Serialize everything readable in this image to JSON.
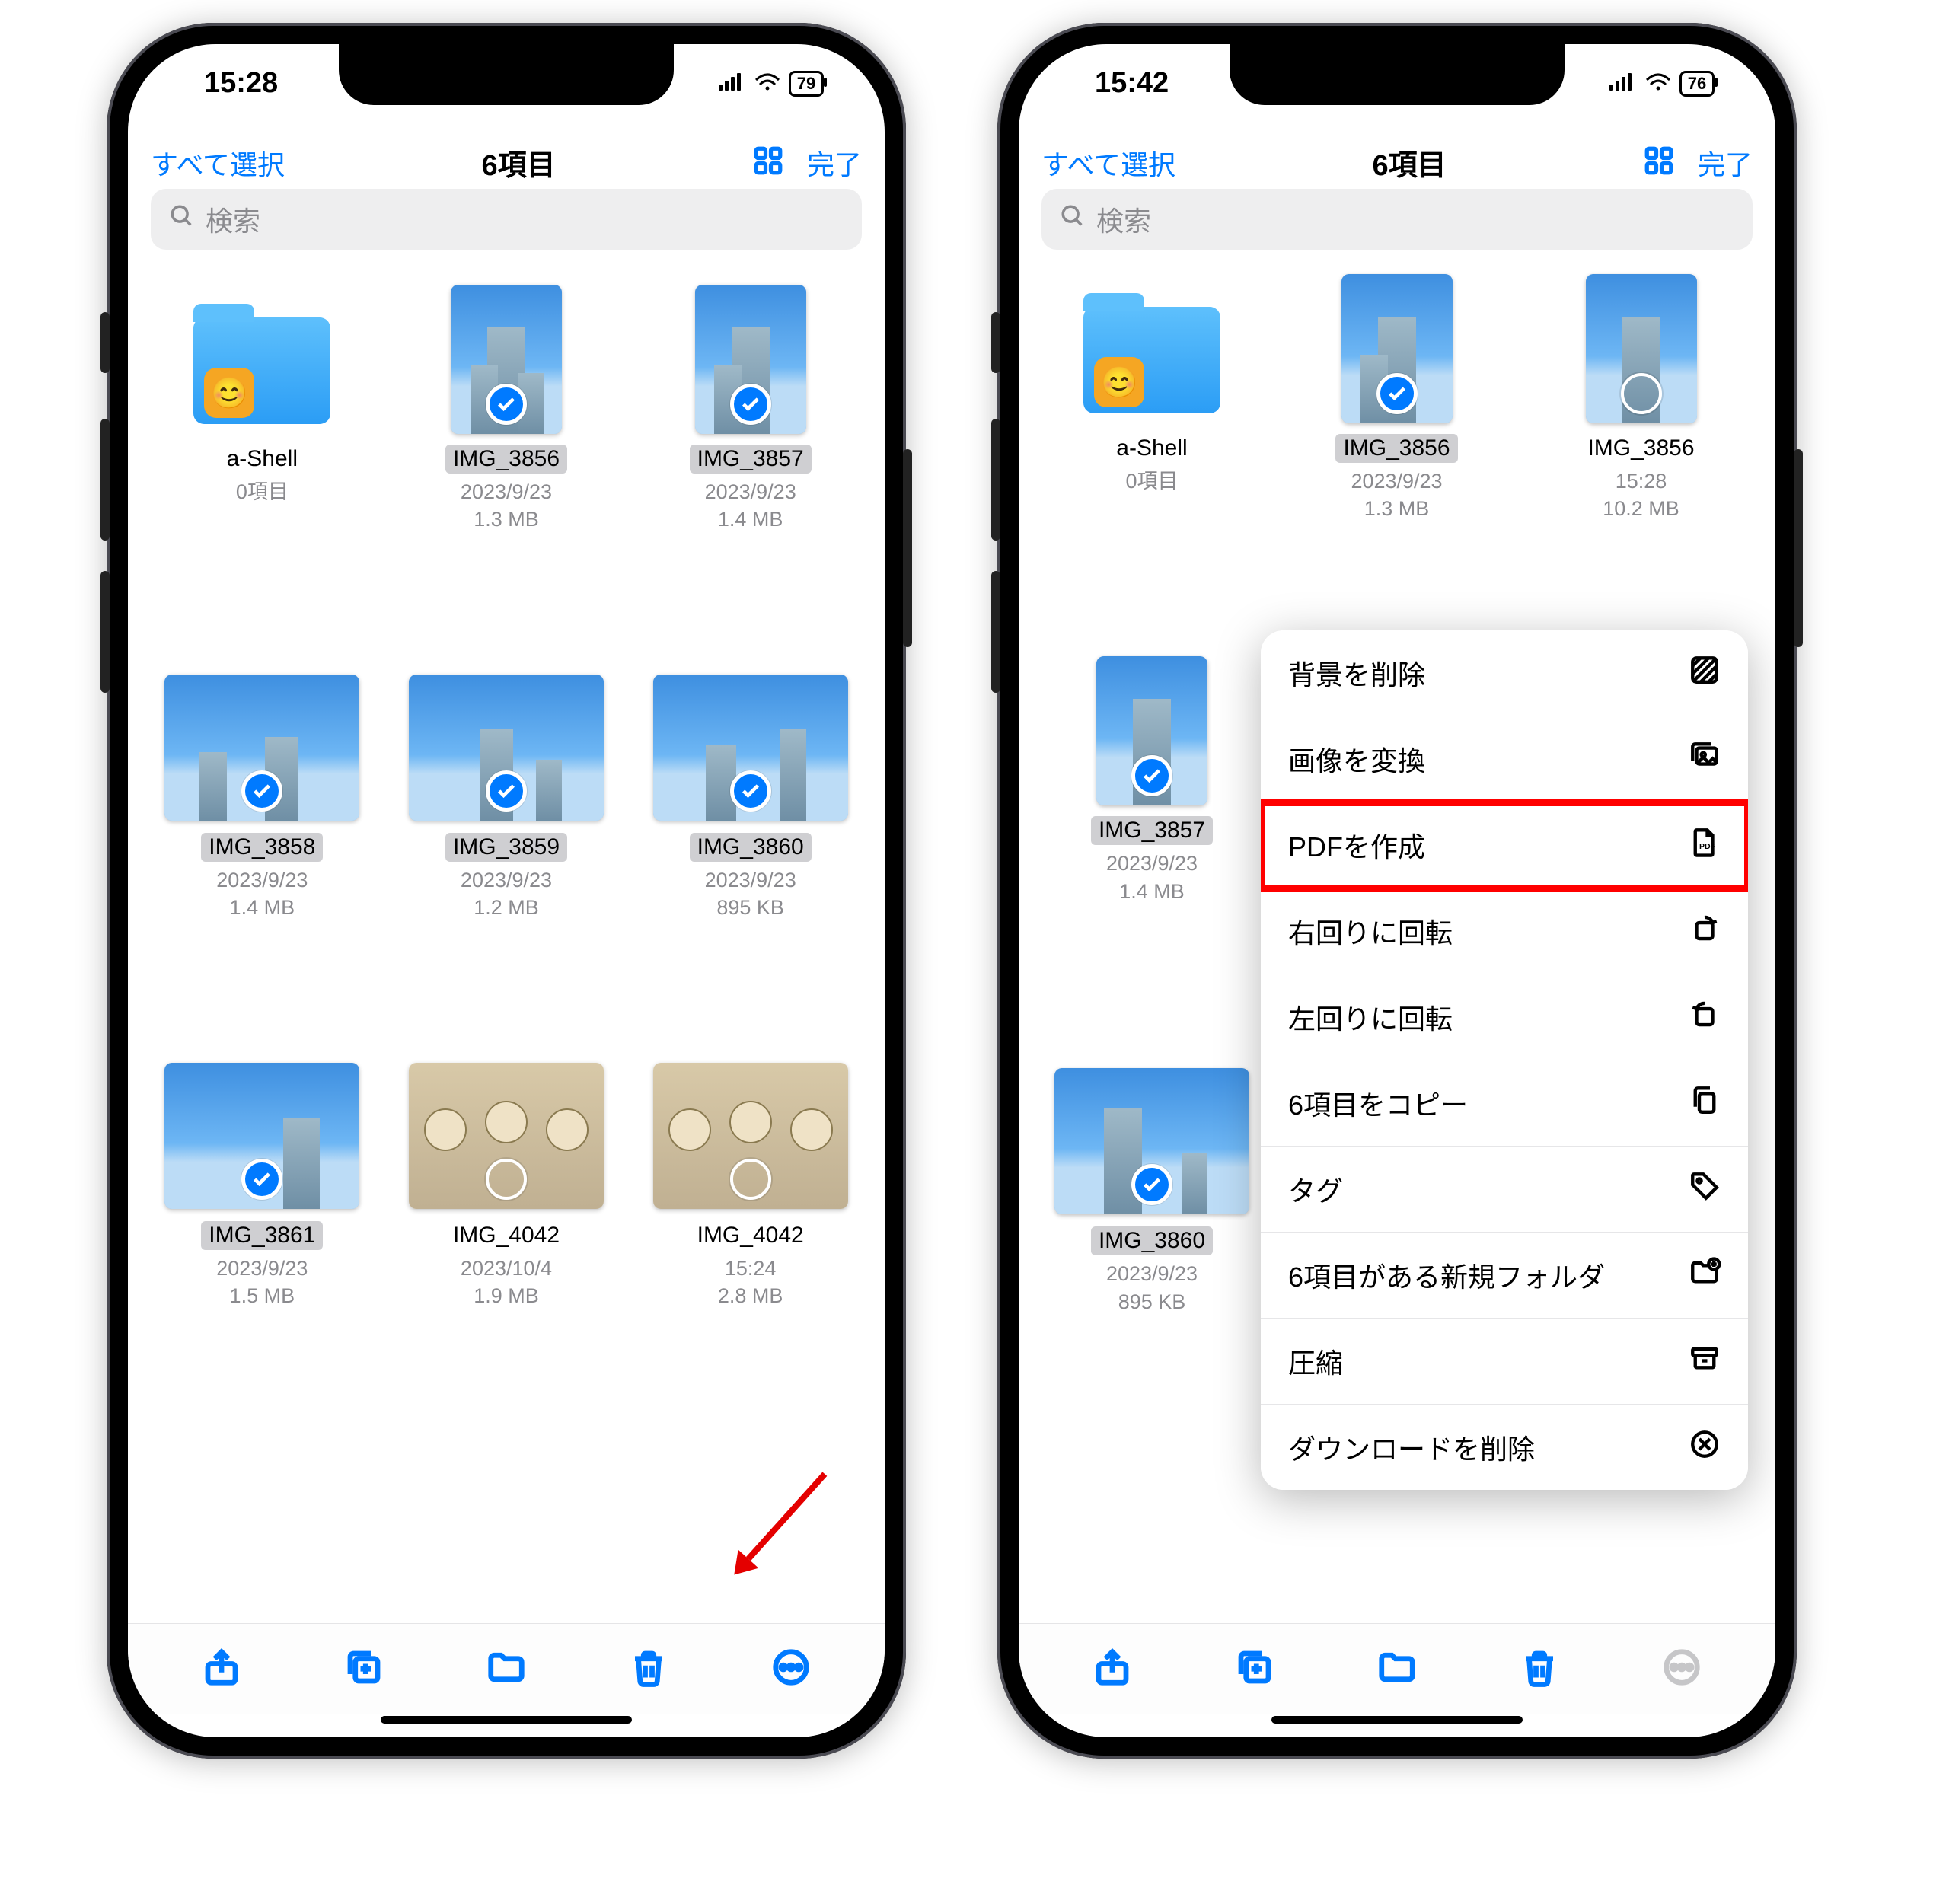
{
  "accent": "#007aff",
  "phones": {
    "left": {
      "status_time": "15:28",
      "battery": "79",
      "select_all": "すべて選択",
      "title": "6項目",
      "done": "完了",
      "search_placeholder": "検索",
      "items": [
        {
          "name": "a-Shell",
          "line1": "0項目",
          "line2": ""
        },
        {
          "name": "IMG_3856",
          "line1": "2023/9/23",
          "line2": "1.3 MB"
        },
        {
          "name": "IMG_3857",
          "line1": "2023/9/23",
          "line2": "1.4 MB"
        },
        {
          "name": "IMG_3858",
          "line1": "2023/9/23",
          "line2": "1.4 MB"
        },
        {
          "name": "IMG_3859",
          "line1": "2023/9/23",
          "line2": "1.2 MB"
        },
        {
          "name": "IMG_3860",
          "line1": "2023/9/23",
          "line2": "895 KB"
        },
        {
          "name": "IMG_3861",
          "line1": "2023/9/23",
          "line2": "1.5 MB"
        },
        {
          "name": "IMG_4042",
          "line1": "2023/10/4",
          "line2": "1.9 MB"
        },
        {
          "name": "IMG_4042",
          "line1": "15:24",
          "line2": "2.8 MB"
        }
      ]
    },
    "right": {
      "status_time": "15:42",
      "battery": "76",
      "select_all": "すべて選択",
      "title": "6項目",
      "done": "完了",
      "search_placeholder": "検索",
      "col_items": [
        {
          "name": "a-Shell",
          "line1": "0項目",
          "line2": ""
        },
        {
          "name": "IMG_3857",
          "line1": "2023/9/23",
          "line2": "1.4 MB"
        },
        {
          "name": "IMG_3860",
          "line1": "2023/9/23",
          "line2": "895 KB"
        }
      ],
      "top_items": [
        {
          "name": "IMG_3856",
          "line1": "2023/9/23",
          "line2": "1.3 MB"
        },
        {
          "name": "IMG_3856",
          "line1": "15:28",
          "line2": "10.2 MB"
        }
      ],
      "menu": [
        "背景を削除",
        "画像を変換",
        "PDFを作成",
        "右回りに回転",
        "左回りに回転",
        "6項目をコピー",
        "タグ",
        "6項目がある新規フォルダ",
        "圧縮",
        "ダウンロードを削除"
      ]
    }
  }
}
